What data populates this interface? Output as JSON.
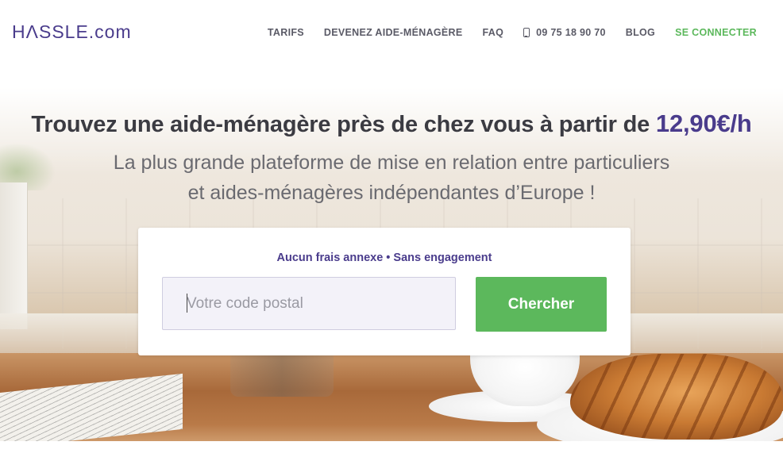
{
  "header": {
    "logo": "HΛSSLE.com",
    "nav": {
      "tarifs": "TARIFS",
      "devenez": "DEVENEZ AIDE-MÉNAGÈRE",
      "faq": "FAQ",
      "phone": "09 75 18 90 70",
      "phone_icon": "phone-icon",
      "blog": "BLOG",
      "connect": "SE CONNECTER"
    }
  },
  "hero": {
    "headline_text": "Trouvez une aide-ménagère près de chez vous à partir de",
    "headline_price": "12,90€/h",
    "subline_1": "La plus grande plateforme de mise en relation entre particuliers",
    "subline_2": "et aides-ménagères indépendantes d’Europe !"
  },
  "search": {
    "tagline": "Aucun frais annexe • Sans engagement",
    "postal_placeholder": "Votre code postal",
    "postal_value": "",
    "button_label": "Chercher"
  },
  "colors": {
    "brand_purple": "#4a3c8c",
    "accent_green": "#5cb85c"
  }
}
